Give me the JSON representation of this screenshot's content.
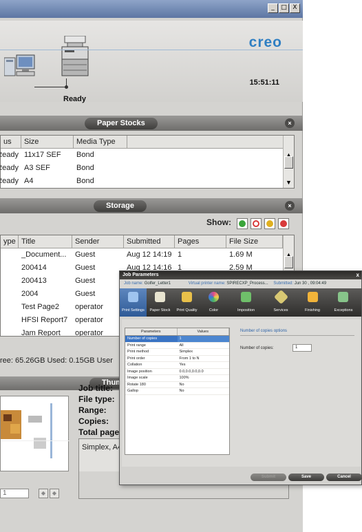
{
  "window": {
    "controls": [
      "_",
      "□",
      "X"
    ]
  },
  "header": {
    "brand": "creo",
    "time": "15:51:11",
    "printer_status": "Ready"
  },
  "paper_stocks": {
    "title": "Paper Stocks",
    "columns": [
      "us",
      "Size",
      "Media Type"
    ],
    "rows": [
      [
        "Ready",
        "11x17 SEF",
        "Bond"
      ],
      [
        "Ready",
        "A3 SEF",
        "Bond"
      ],
      [
        "Ready",
        "A4",
        "Bond"
      ]
    ]
  },
  "storage": {
    "title": "Storage",
    "show_label": "Show:",
    "filter_colors": [
      "#3aa53a",
      "#d83a3a",
      "#e0b020",
      "#d83a3a"
    ],
    "columns": [
      "ype",
      "Title",
      "Sender",
      "Submitted",
      "Pages",
      "File Size"
    ],
    "rows": [
      [
        "",
        "_Document...",
        "Guest",
        "Aug 12 14:19",
        "1",
        "1.69 M"
      ],
      [
        "",
        "200414",
        "Guest",
        "Aug 12 14:16",
        "1",
        "2.59 M"
      ],
      [
        "",
        "200413",
        "Guest",
        "",
        "",
        ""
      ],
      [
        "",
        "2004",
        "Guest",
        "",
        "",
        ""
      ],
      [
        "",
        "Test Page2",
        "operator",
        "",
        "",
        ""
      ],
      [
        "",
        "HFSI Report7",
        "operator",
        "",
        "",
        ""
      ],
      [
        "",
        "Jam Report",
        "operator",
        "",
        "",
        ""
      ]
    ],
    "disk_info": "ree: 65.26GB Used: 0.15GB  User"
  },
  "thumbnail": {
    "title": "Thum",
    "labels": [
      "Job title:",
      "File type:",
      "Range:",
      "Copies:",
      "Total pages"
    ],
    "summary": "Simplex, A4",
    "page_value": "1"
  },
  "dialog": {
    "title": "Job Parameters",
    "close": "x",
    "job_name_label": "Job name:",
    "job_name": "Golfer_Letter1",
    "vp_label": "Virtual printer name:",
    "vp_name": "SPIRECXP_Process...",
    "submitted_label": "Submitted:",
    "submitted": "Jun 30 , 09:04:49",
    "tabs": [
      {
        "label": "Print Settings",
        "icon": "print-settings-icon",
        "color": "#9fc4ef"
      },
      {
        "label": "Paper Stock",
        "icon": "paper-stock-icon",
        "color": "#e8e4d0"
      },
      {
        "label": "Print Quality",
        "icon": "print-quality-icon",
        "color": "#e9c04a"
      },
      {
        "label": "Color",
        "icon": "color-icon",
        "color": "#e24a8a"
      },
      {
        "label": "Imposition",
        "icon": "imposition-icon",
        "color": "#6fbf6a"
      },
      {
        "label": "Services",
        "icon": "services-icon",
        "color": "#d8c873"
      },
      {
        "label": "Finishing",
        "icon": "finishing-icon",
        "color": "#f2b43a"
      },
      {
        "label": "Exceptions",
        "icon": "exceptions-icon",
        "color": "#87c48a"
      }
    ],
    "param_header": [
      "Parameters",
      "Values"
    ],
    "params": [
      [
        "Number of copies",
        "1"
      ],
      [
        "Print range",
        "All"
      ],
      [
        "Print method",
        "Simplex"
      ],
      [
        "Print order",
        "From 1 to N"
      ],
      [
        "Collation",
        "Yes"
      ],
      [
        "Image position",
        "0.0,0.0,0.0,0.0"
      ],
      [
        "Image scale",
        "100%"
      ],
      [
        "Rotate 180",
        "No"
      ],
      [
        "Gallop",
        "No"
      ]
    ],
    "options_title": "Number of copies options",
    "copies_label": "Number of copies:",
    "copies_value": "1",
    "buttons": {
      "submit": "Submit",
      "save": "Save",
      "cancel": "Cancel"
    }
  }
}
